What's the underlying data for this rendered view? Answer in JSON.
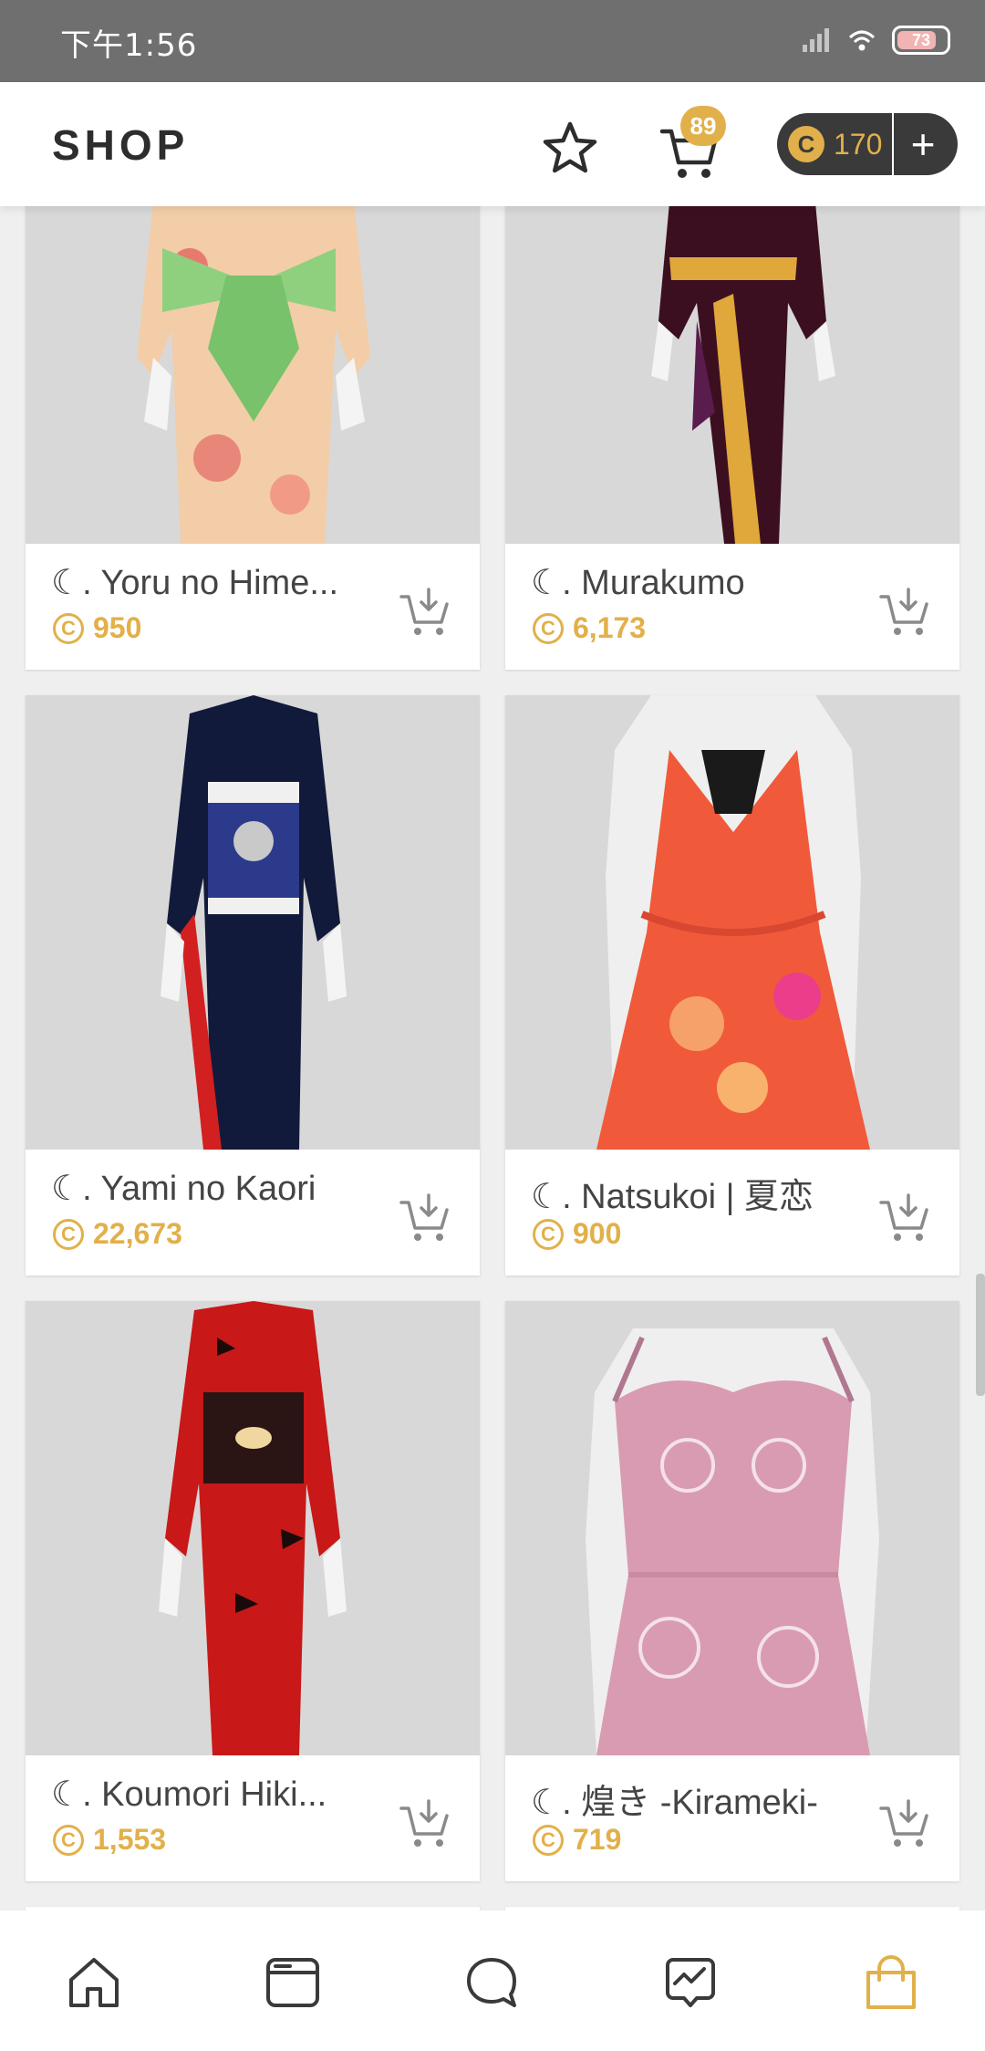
{
  "status_bar": {
    "time": "下午1:56",
    "battery": "73"
  },
  "header": {
    "title": "SHOP",
    "cart_count": "89",
    "coins": "170",
    "add_coins_label": "+"
  },
  "products": [
    {
      "name": "☾. Yoru no Hime...",
      "price": "950"
    },
    {
      "name": "☾. Murakumo",
      "price": "6,173"
    },
    {
      "name": "☾. Yami no Kaori",
      "price": "22,673"
    },
    {
      "name": "☾. Natsukoi | 夏恋",
      "price": "900"
    },
    {
      "name": "☾. Koumori Hiki...",
      "price": "1,553"
    },
    {
      "name": "☾. 煌き -Kirameki-",
      "price": "719"
    }
  ],
  "bottom_nav": [
    {
      "icon": "home-icon"
    },
    {
      "icon": "browser-icon"
    },
    {
      "icon": "chat-icon"
    },
    {
      "icon": "activity-icon"
    },
    {
      "icon": "shopping-bag-icon",
      "active": true
    }
  ],
  "colors": {
    "accent": "#e2b04a",
    "text": "#444444",
    "header_dark": "#3a3a3a"
  }
}
